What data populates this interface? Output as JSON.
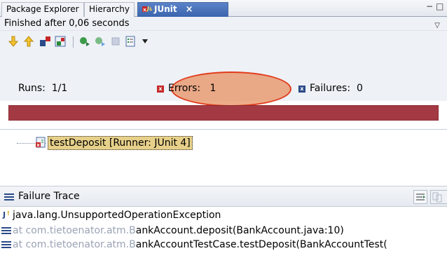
{
  "tabs": {
    "package_explorer": "Package Explorer",
    "hierarchy": "Hierarchy",
    "junit": "JUnit",
    "close_glyph": "×"
  },
  "window_controls": {
    "minimize_glyph": "−",
    "maximize_glyph": "□"
  },
  "status": {
    "text": "Finished after 0,06 seconds"
  },
  "toolbar": {
    "buttons": [
      "next-failure-icon",
      "previous-failure-icon",
      "show-failures-only-icon",
      "scroll-lock-icon",
      "rerun-test-icon",
      "rerun-failed-first-icon",
      "stop-icon",
      "test-run-history-icon",
      "view-menu-icon"
    ]
  },
  "counters": {
    "runs_label": "Runs:",
    "runs_value": "1/1",
    "errors_label": "Errors:",
    "errors_value": "1",
    "failures_label": "Failures:",
    "failures_value": "0"
  },
  "progress": {
    "state": "failed",
    "color": "#a33a43",
    "fraction": 1.0
  },
  "tree": {
    "items": [
      {
        "label": "testDeposit [Runner: JUnit 4]",
        "status": "error"
      }
    ]
  },
  "failure_trace": {
    "title": "Failure Trace",
    "lines": [
      {
        "prefix": "",
        "text": "java.lang.UnsupportedOperationException",
        "icon": "exception-icon"
      },
      {
        "prefix": "at ",
        "faded": "com.tietoenator.atm.B",
        "text": "ankAccount.deposit(BankAccount.java:10)",
        "icon": "stack-frame-icon"
      },
      {
        "prefix": "at ",
        "faded": "com.tietoenator.atm.B",
        "text": "ankAccountTestCase.testDeposit(BankAccountTest(",
        "icon": "stack-frame-icon"
      }
    ]
  },
  "colors": {
    "accent": "#3a64ad",
    "error": "#c62828",
    "highlight_ellipse": "#e23a1c"
  }
}
